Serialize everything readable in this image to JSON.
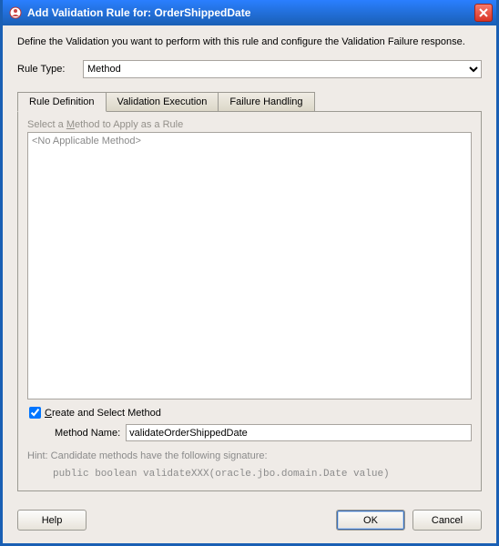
{
  "titlebar": {
    "prefix": "Add Validation Rule for: ",
    "entity": "OrderShippedDate"
  },
  "intro": "Define the Validation you want to perform with this rule and configure the Validation Failure response.",
  "ruleType": {
    "label": "Rule Type:",
    "value": "Method"
  },
  "tabs": {
    "definition": "Rule Definition",
    "execution": "Validation Execution",
    "failure": "Failure Handling"
  },
  "panel": {
    "selectMethodLabelPre": "Select a ",
    "selectMethodLabelU": "M",
    "selectMethodLabelPost": "ethod to Apply as a Rule",
    "listPlaceholder": "<No Applicable Method>",
    "createLabelU": "C",
    "createLabelPost": "reate and Select Method",
    "createChecked": true,
    "nameLabel": "Method Name:",
    "nameValue": "validateOrderShippedDate"
  },
  "hint": {
    "line1": "Hint: Candidate methods have the following signature:",
    "code": "public boolean validateXXX(oracle.jbo.domain.Date value)"
  },
  "buttons": {
    "help": "Help",
    "ok": "OK",
    "cancel": "Cancel"
  }
}
